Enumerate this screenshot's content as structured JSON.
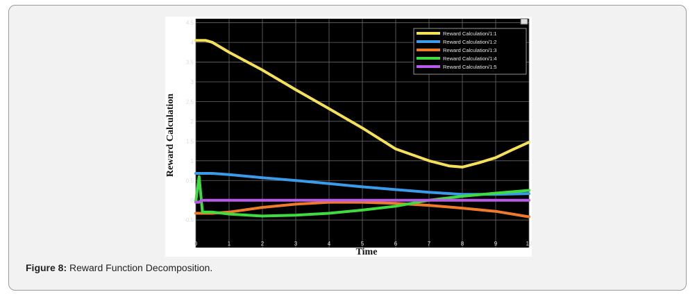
{
  "caption": {
    "label": "Figure 8:",
    "text": " Reward Function Decomposition."
  },
  "chart_data": {
    "type": "line",
    "xlabel": "Time",
    "ylabel": "Reward Calculation",
    "xlim": [
      0,
      10
    ],
    "ylim": [
      -1.2,
      4.6
    ],
    "xticks": [
      "0",
      "1",
      "2",
      "3",
      "4",
      "5",
      "6",
      "7",
      "8",
      "9",
      "10"
    ],
    "yticks": [
      "-0.5",
      "0",
      "0.5",
      "1",
      "1.5",
      "2",
      "2.5",
      "3",
      "3.5",
      "4",
      "4.5"
    ],
    "ytick_values": [
      -0.5,
      0,
      0.5,
      1,
      1.5,
      2,
      2.5,
      3,
      3.5,
      4,
      4.5
    ],
    "grid": true,
    "background": "#000000",
    "legend_position": "top-right",
    "series": [
      {
        "name": "Reward Calculation/1:1",
        "color": "#f5e05a",
        "x": [
          0,
          0.3,
          0.5,
          1,
          2,
          3,
          4,
          5,
          6,
          7,
          7.6,
          8,
          8.5,
          9,
          9.5,
          10
        ],
        "y": [
          4.05,
          4.05,
          4.0,
          3.75,
          3.3,
          2.8,
          2.32,
          1.83,
          1.3,
          1.0,
          0.87,
          0.84,
          0.95,
          1.08,
          1.28,
          1.47
        ]
      },
      {
        "name": "Reward Calculation/1:2",
        "color": "#3a9be8",
        "x": [
          0,
          0.1,
          0.5,
          1,
          2,
          3,
          4,
          5,
          6,
          7,
          8,
          9,
          10
        ],
        "y": [
          0.68,
          0.68,
          0.68,
          0.65,
          0.57,
          0.5,
          0.42,
          0.34,
          0.27,
          0.2,
          0.15,
          0.15,
          0.17
        ]
      },
      {
        "name": "Reward Calculation/1:3",
        "color": "#ee7a2b",
        "x": [
          0,
          0.5,
          1,
          2,
          3,
          4,
          5,
          6,
          7,
          8,
          9,
          10
        ],
        "y": [
          -0.33,
          -0.33,
          -0.3,
          -0.18,
          -0.1,
          -0.05,
          -0.05,
          -0.08,
          -0.13,
          -0.2,
          -0.28,
          -0.42
        ]
      },
      {
        "name": "Reward Calculation/1:4",
        "color": "#3fdc3f",
        "x": [
          0,
          0.1,
          0.2,
          0.5,
          1,
          2,
          3,
          4,
          5,
          6,
          7,
          8,
          9,
          10
        ],
        "y": [
          -0.03,
          0.6,
          -0.3,
          -0.3,
          -0.35,
          -0.4,
          -0.38,
          -0.33,
          -0.25,
          -0.15,
          0.0,
          0.1,
          0.18,
          0.25
        ]
      },
      {
        "name": "Reward Calculation/1:5",
        "color": "#b95ae8",
        "x": [
          0,
          0.1,
          0.2,
          1,
          10
        ],
        "y": [
          -0.05,
          -0.05,
          0.0,
          0.0,
          0.0
        ]
      }
    ]
  }
}
